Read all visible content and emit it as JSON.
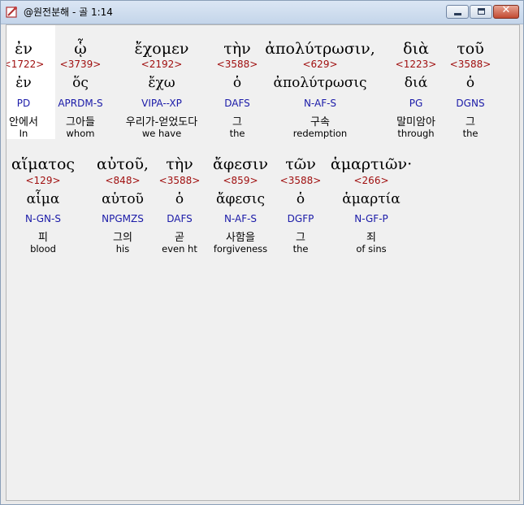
{
  "window": {
    "title": "@원전분해 - 골 1:14",
    "controls": {
      "minimize": "minimize",
      "maximize": "maximize",
      "close": "✕"
    }
  },
  "line1": [
    {
      "greek": "ἐν",
      "strong": "<1722>",
      "lemma": "ἐν",
      "morph": "PD",
      "korean": "안에서",
      "english": "In"
    },
    {
      "greek": "ᾧ",
      "strong": "<3739>",
      "lemma": "ὅς",
      "morph": "APRDM-S",
      "korean": "그아들",
      "english": "whom"
    },
    {
      "greek": "ἔχομεν",
      "strong": "<2192>",
      "lemma": "ἔχω",
      "morph": "VIPA--XP",
      "korean": "우리가-얻었도다",
      "english": "we have"
    },
    {
      "greek": "τὴν",
      "strong": "<3588>",
      "lemma": "ὁ",
      "morph": "DAFS",
      "korean": "그",
      "english": "the"
    },
    {
      "greek": "ἀπολύτρωσιν,",
      "strong": "<629>",
      "lemma": "ἀπολύτρωσις",
      "morph": "N-AF-S",
      "korean": "구속",
      "english": "redemption"
    },
    {
      "greek": "διὰ",
      "strong": "<1223>",
      "lemma": "διά",
      "morph": "PG",
      "korean": "말미암아",
      "english": "through"
    },
    {
      "greek": "τοῦ",
      "strong": "<3588>",
      "lemma": "ὁ",
      "morph": "DGNS",
      "korean": "그",
      "english": "the"
    }
  ],
  "line2": [
    {
      "greek": "αἵματος",
      "strong": "<129>",
      "lemma": "αἷμα",
      "morph": "N-GN-S",
      "korean": "피",
      "english": "blood"
    },
    {
      "greek": "αὐτοῦ,",
      "strong": "<848>",
      "lemma": "αὑτοῦ",
      "morph": "NPGMZS",
      "korean": "그의",
      "english": "his"
    },
    {
      "greek": "τὴν",
      "strong": "<3588>",
      "lemma": "ὁ",
      "morph": "DAFS",
      "korean": "곧",
      "english": "even ht"
    },
    {
      "greek": "ἄφεσιν",
      "strong": "<859>",
      "lemma": "ἄφεσις",
      "morph": "N-AF-S",
      "korean": "사함을",
      "english": "forgiveness"
    },
    {
      "greek": "τῶν",
      "strong": "<3588>",
      "lemma": "ὁ",
      "morph": "DGFP",
      "korean": "그",
      "english": "the"
    },
    {
      "greek": "ἁμαρτιῶν·",
      "strong": "<266>",
      "lemma": "ἁμαρτία",
      "morph": "N-GF-P",
      "korean": "죄",
      "english": "of sins"
    }
  ],
  "colors": {
    "strong": "#a01010",
    "morph": "#1a1aa8",
    "text": "#000000",
    "background": "#f0f0f0",
    "highlight": "#ffffff"
  }
}
